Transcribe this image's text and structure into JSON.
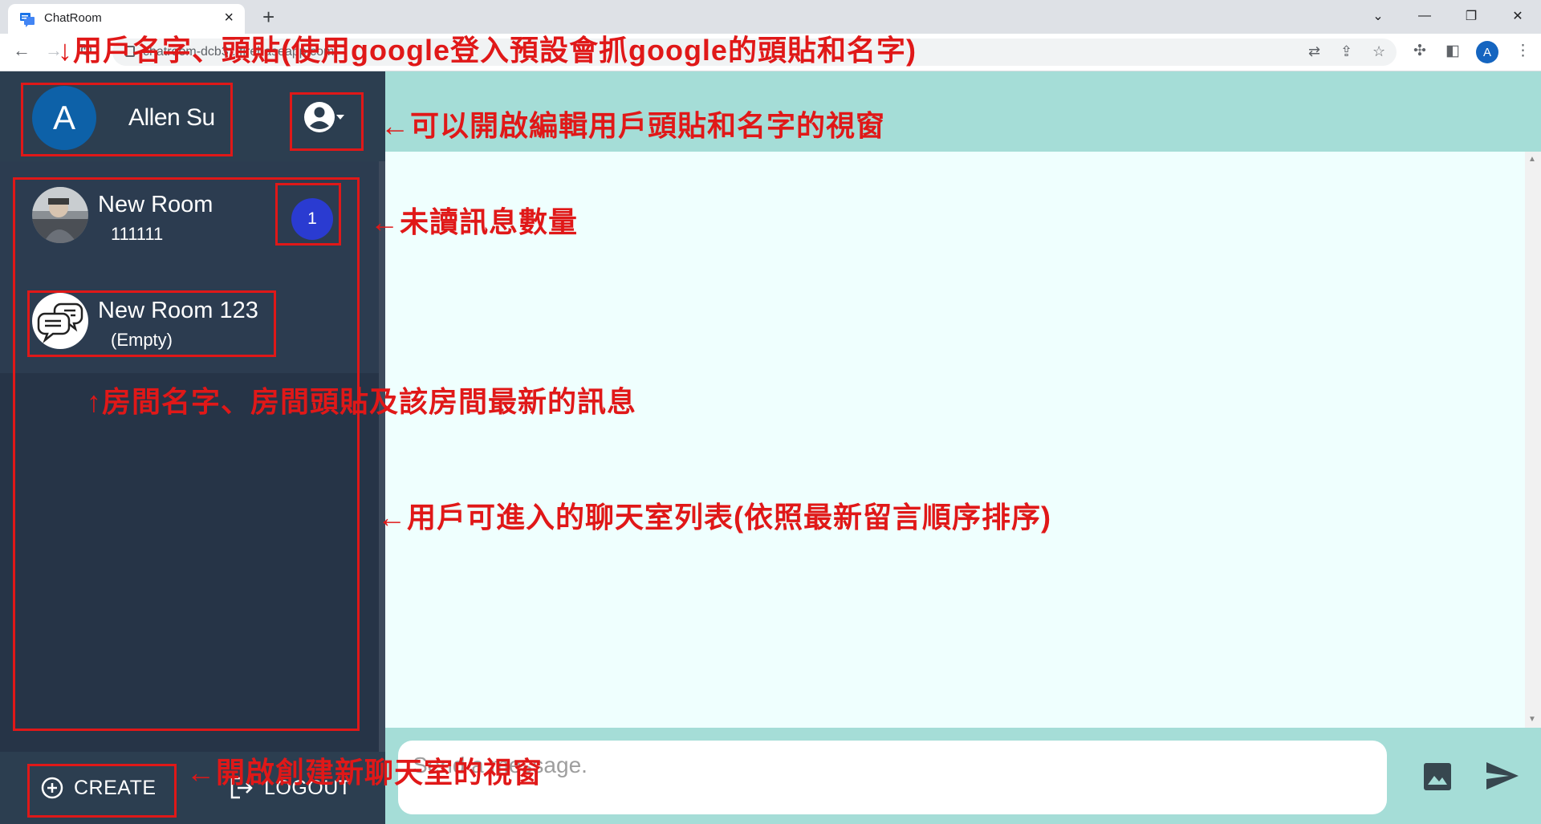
{
  "browser": {
    "tab_title": "ChatRoom",
    "url": "chatroom-dcb3...firebaseapp.com",
    "profile_initial": "A"
  },
  "user": {
    "initial": "A",
    "name": "Allen Su"
  },
  "rooms": [
    {
      "name": "New Room",
      "last_message": "111111",
      "unread": "1"
    },
    {
      "name": "New Room 123",
      "last_message": "(Empty)"
    }
  ],
  "footer": {
    "create_label": "CREATE",
    "logout_label": "LOGOUT"
  },
  "composer": {
    "placeholder": "Send a message."
  },
  "annotations": {
    "user_info": "↓用戶名字、頭貼(使用google登入預設會抓google的頭貼和名字)",
    "edit_profile": "←可以開啟編輯用戶頭貼和名字的視窗",
    "unread_count": "←未讀訊息數量",
    "room_info": "↑房間名字、房間頭貼及該房間最新的訊息",
    "room_list": "←用戶可進入的聊天室列表(依照最新留言順序排序)",
    "create_room": "←開啟創建新聊天室的視窗"
  },
  "colors": {
    "sidebar": "#2b3a4d",
    "header_teal": "#a5ddd7",
    "chat_bg": "#effffe",
    "annotation_red": "#e01818",
    "badge_blue": "#2a3bd1"
  }
}
